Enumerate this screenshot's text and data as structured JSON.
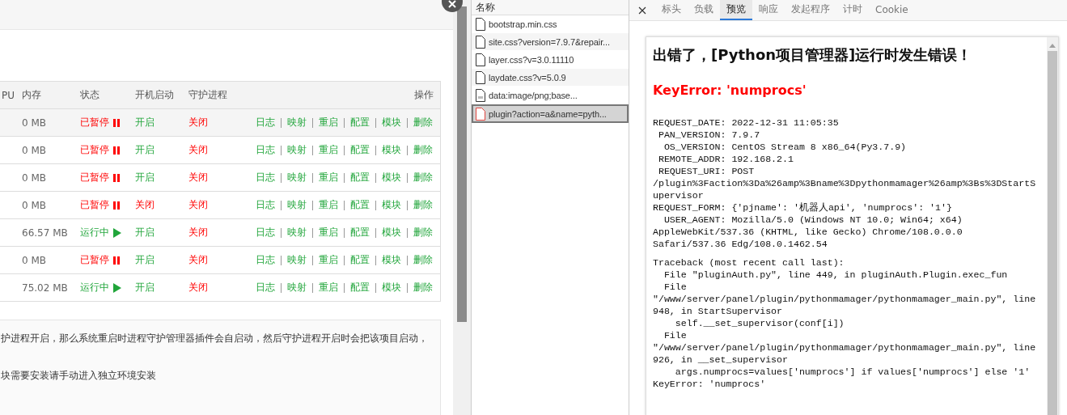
{
  "table": {
    "columns": [
      "PU",
      "内存",
      "状态",
      "开机启动",
      "守护进程",
      "操作"
    ],
    "rows": [
      {
        "memory": "0 MB",
        "status": {
          "text": "已暂停",
          "kind": "paused"
        },
        "autostart": {
          "text": "开启",
          "on": true
        },
        "daemon": {
          "text": "关闭",
          "on": false
        },
        "actions": [
          "日志",
          "映射",
          "重启",
          "配置",
          "模块",
          "删除"
        ]
      },
      {
        "memory": "0 MB",
        "status": {
          "text": "已暂停",
          "kind": "paused"
        },
        "autostart": {
          "text": "开启",
          "on": true
        },
        "daemon": {
          "text": "关闭",
          "on": false
        },
        "actions": [
          "日志",
          "映射",
          "重启",
          "配置",
          "模块",
          "删除"
        ]
      },
      {
        "memory": "0 MB",
        "status": {
          "text": "已暂停",
          "kind": "paused"
        },
        "autostart": {
          "text": "开启",
          "on": true
        },
        "daemon": {
          "text": "关闭",
          "on": false
        },
        "actions": [
          "日志",
          "映射",
          "重启",
          "配置",
          "模块",
          "删除"
        ]
      },
      {
        "memory": "0 MB",
        "status": {
          "text": "已暂停",
          "kind": "paused"
        },
        "autostart": {
          "text": "关闭",
          "on": false
        },
        "daemon": {
          "text": "关闭",
          "on": false
        },
        "actions": [
          "日志",
          "映射",
          "重启",
          "配置",
          "模块",
          "删除"
        ]
      },
      {
        "memory": "66.57 MB",
        "status": {
          "text": "运行中",
          "kind": "running"
        },
        "autostart": {
          "text": "开启",
          "on": true
        },
        "daemon": {
          "text": "关闭",
          "on": false
        },
        "actions": [
          "日志",
          "映射",
          "重启",
          "配置",
          "模块",
          "删除"
        ]
      },
      {
        "memory": "0 MB",
        "status": {
          "text": "已暂停",
          "kind": "paused"
        },
        "autostart": {
          "text": "开启",
          "on": true
        },
        "daemon": {
          "text": "关闭",
          "on": false
        },
        "actions": [
          "日志",
          "映射",
          "重启",
          "配置",
          "模块",
          "删除"
        ]
      },
      {
        "memory": "75.02 MB",
        "status": {
          "text": "运行中",
          "kind": "running"
        },
        "autostart": {
          "text": "开启",
          "on": true
        },
        "daemon": {
          "text": "关闭",
          "on": false
        },
        "actions": [
          "日志",
          "映射",
          "重启",
          "配置",
          "模块",
          "删除"
        ]
      }
    ]
  },
  "notes": [
    "护进程开启，那么系统重启时进程守护管理器插件会自启动，然后守护进程开启时会把该项目启动，",
    "块需要安装请手动进入独立环境安装"
  ],
  "network": {
    "header": "名称",
    "requests": [
      {
        "name": "bootstrap.min.css",
        "kind": "file",
        "selected": false
      },
      {
        "name": "site.css?version=7.9.7&repair...",
        "kind": "file",
        "selected": false
      },
      {
        "name": "layer.css?v=3.0.11110",
        "kind": "file",
        "selected": false
      },
      {
        "name": "laydate.css?v=5.0.9",
        "kind": "file",
        "selected": false
      },
      {
        "name": "data:image/png;base...",
        "kind": "image",
        "selected": false
      },
      {
        "name": "plugin?action=a&name=pyth...",
        "kind": "error",
        "selected": true
      }
    ]
  },
  "details": {
    "tabs": [
      {
        "label": "标头",
        "selected": false
      },
      {
        "label": "负载",
        "selected": false
      },
      {
        "label": "预览",
        "selected": true
      },
      {
        "label": "响应",
        "selected": false
      },
      {
        "label": "发起程序",
        "selected": false
      },
      {
        "label": "计时",
        "selected": false
      },
      {
        "label": "Cookie",
        "selected": false
      }
    ],
    "preview": {
      "title": "出错了，[Python项目管理器]运行时发生错误！",
      "error": "KeyError: 'numprocs'",
      "request_lines": [
        "REQUEST_DATE: 2022-12-31 11:05:35",
        " PAN_VERSION: 7.9.7",
        "  OS_VERSION: CentOS Stream 8 x86_64(Py3.7.9)",
        " REMOTE_ADDR: 192.168.2.1",
        " REQUEST_URI: POST",
        "/plugin%3Faction%3Da%26amp%3Bname%3Dpythonmamager%26amp%3Bs%3DStartS",
        "upervisor",
        "REQUEST_FORM: {'pjname': '机器人api', 'numprocs': '1'}",
        "  USER_AGENT: Mozilla/5.0 (Windows NT 10.0; Win64; x64)",
        "AppleWebKit/537.36 (KHTML, like Gecko) Chrome/108.0.0.0",
        "Safari/537.36 Edg/108.0.1462.54"
      ],
      "traceback_lines": [
        "Traceback (most recent call last):",
        "  File \"pluginAuth.py\", line 449, in pluginAuth.Plugin.exec_fun",
        "  File",
        "\"/www/server/panel/plugin/pythonmamager/pythonmamager_main.py\", line",
        "948, in StartSupervisor",
        "    self.__set_supervisor(conf[i])",
        "  File",
        "\"/www/server/panel/plugin/pythonmamager/pythonmamager_main.py\", line",
        "926, in __set_supervisor",
        "    args.numprocs=values['numprocs'] if values['numprocs'] else '1'",
        "KeyError: 'numprocs'"
      ]
    }
  }
}
